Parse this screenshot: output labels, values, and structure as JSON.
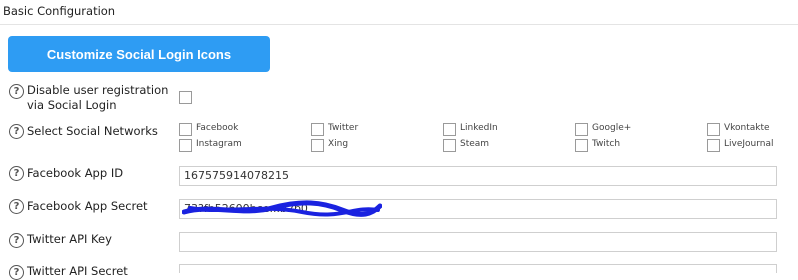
{
  "section": {
    "title": "Basic Configuration"
  },
  "button": {
    "label": "Customize Social Login Icons"
  },
  "fields": {
    "disable_registration": {
      "label_line1": "Disable user registration",
      "label_line2": "via Social Login"
    },
    "select_networks": {
      "label": "Select Social Networks"
    },
    "facebook_app_id": {
      "label": "Facebook App ID",
      "value": "167575914078215"
    },
    "facebook_app_secret": {
      "label": "Facebook App Secret",
      "value": "73?fb52600bce...b2b0"
    },
    "twitter_api_key": {
      "label": "Twitter API Key",
      "value": ""
    },
    "twitter_api_secret": {
      "label": "Twitter API Secret"
    }
  },
  "networks": [
    "Facebook",
    "Twitter",
    "LinkedIn",
    "Google+",
    "Vkontakte",
    "Instagram",
    "Xing",
    "Steam",
    "Twitch",
    "LiveJournal"
  ],
  "colors": {
    "button_bg": "#2e9cf3",
    "redaction": "#1a22e0"
  }
}
